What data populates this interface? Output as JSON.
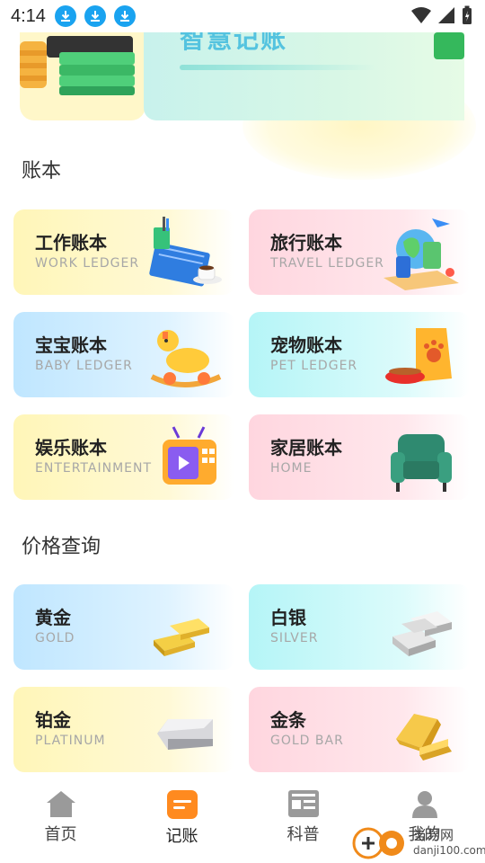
{
  "status_bar": {
    "time": "4:14"
  },
  "banner": {
    "title": "智慧记账"
  },
  "sections": {
    "ledgers_title": "账本",
    "prices_title": "价格查询"
  },
  "ledgers": [
    {
      "title": "工作账本",
      "subtitle": "WORK LEDGER",
      "icon": "desk-icon"
    },
    {
      "title": "旅行账本",
      "subtitle": "TRAVEL LEDGER",
      "icon": "globe-luggage-icon"
    },
    {
      "title": "宝宝账本",
      "subtitle": "BABY LEDGER",
      "icon": "rocking-horse-icon"
    },
    {
      "title": "宠物账本",
      "subtitle": "PET LEDGER",
      "icon": "pet-food-icon"
    },
    {
      "title": "娱乐账本",
      "subtitle": "ENTERTAINMENT",
      "icon": "tv-icon"
    },
    {
      "title": "家居账本",
      "subtitle": "HOME",
      "icon": "armchair-icon"
    }
  ],
  "prices": [
    {
      "title": "黄金",
      "subtitle": "GOLD",
      "icon": "gold-bars-icon"
    },
    {
      "title": "白银",
      "subtitle": "SILVER",
      "icon": "silver-bars-icon"
    },
    {
      "title": "铂金",
      "subtitle": "PLATINUM",
      "icon": "platinum-bar-icon"
    },
    {
      "title": "金条",
      "subtitle": "GOLD BAR",
      "icon": "gold-bullion-icon"
    }
  ],
  "nav": [
    {
      "label": "首页",
      "icon": "home-icon"
    },
    {
      "label": "记账",
      "icon": "ledger-icon",
      "active": true
    },
    {
      "label": "科普",
      "icon": "news-icon"
    },
    {
      "label": "我的",
      "icon": "profile-icon"
    }
  ],
  "watermark": {
    "name": "当易网",
    "url": "danji100.com"
  },
  "colors": {
    "accent": "#ff8a1f",
    "status_download": "#1aa3f0",
    "nav_icon": "#9a9a9a"
  }
}
